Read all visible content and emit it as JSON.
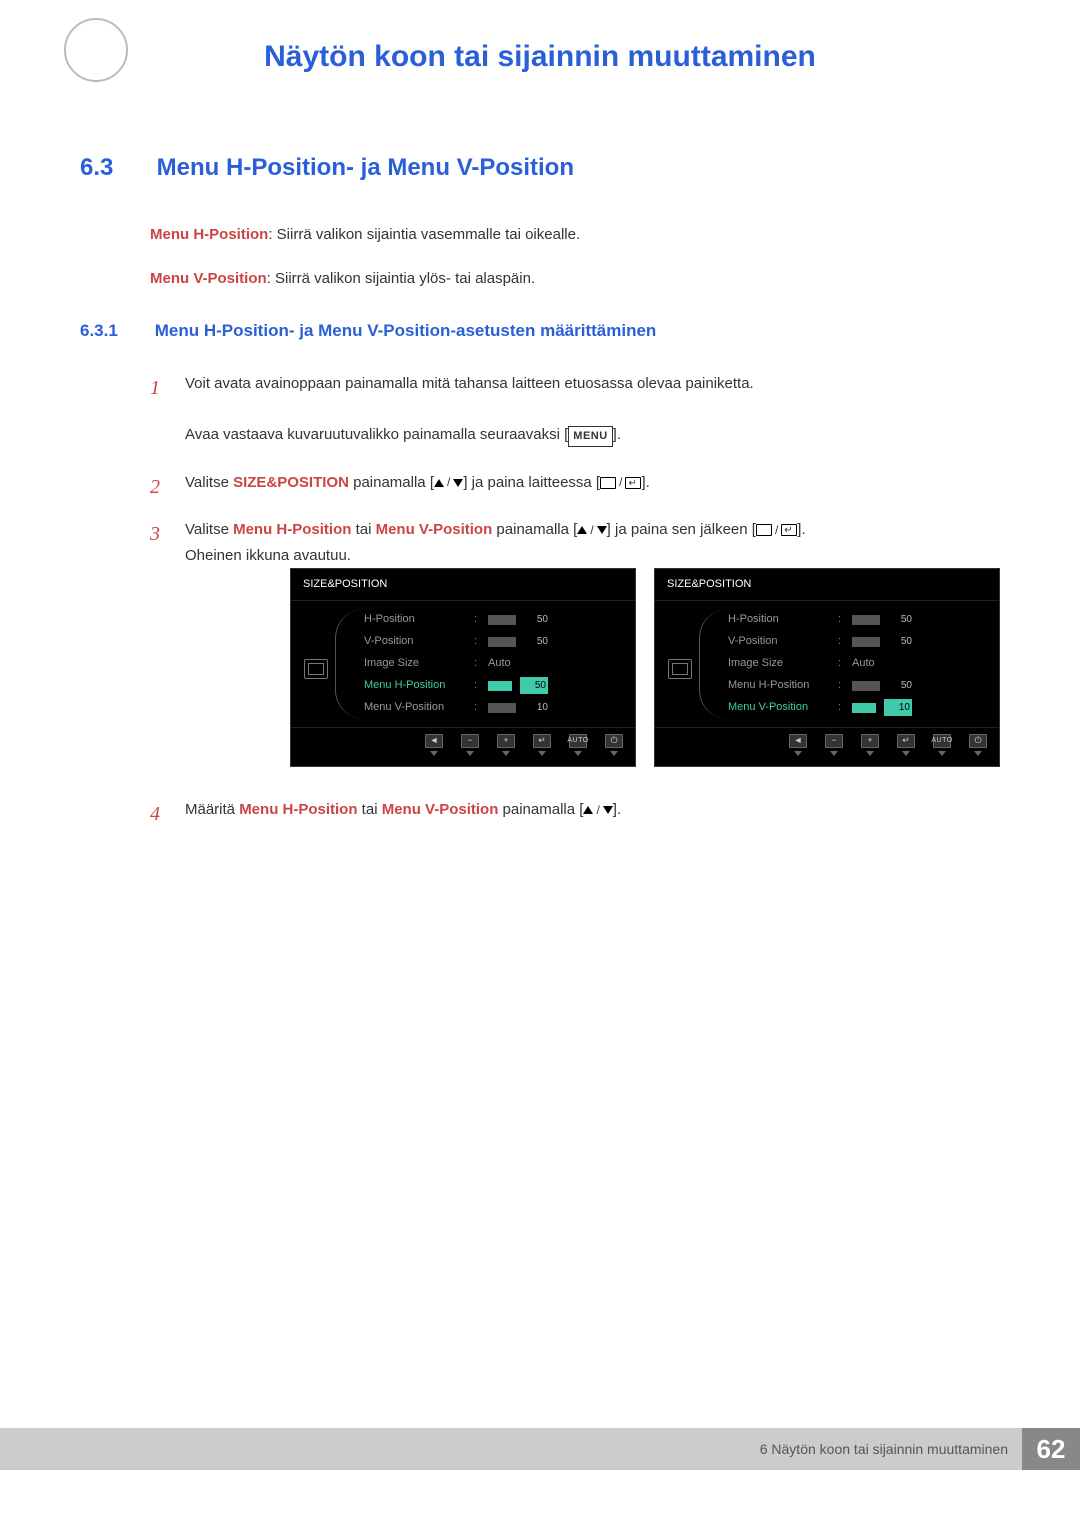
{
  "chapter_title": "Näytön koon tai sijainnin muuttaminen",
  "section": {
    "number": "6.3",
    "title": "Menu H-Position- ja Menu V-Position"
  },
  "intro": {
    "h_label": "Menu H-Position",
    "h_text": ": Siirrä valikon sijaintia vasemmalle tai oikealle.",
    "v_label": "Menu V-Position",
    "v_text": ": Siirrä valikon sijaintia ylös- tai alaspäin."
  },
  "subsection": {
    "number": "6.3.1",
    "title": "Menu H-Position- ja Menu V-Position-asetusten määrittäminen"
  },
  "steps": {
    "s1a": "Voit avata avainoppaan painamalla mitä tahansa laitteen etuosassa olevaa painiketta.",
    "s1b_pre": "Avaa vastaava kuvaruutuvalikko painamalla seuraavaksi [",
    "s1b_key": "MENU",
    "s1b_post": "].",
    "s2_pre": "Valitse ",
    "s2_bold": "SIZE&POSITION",
    "s2_mid": " painamalla [",
    "s2_mid2": "] ja paina laitteessa [",
    "s2_post": "].",
    "s3_pre": "Valitse ",
    "s3_b1": "Menu H-Position",
    "s3_or": " tai ",
    "s3_b2": "Menu V-Position",
    "s3_mid": " painamalla [",
    "s3_mid2": "] ja paina sen jälkeen [",
    "s3_post": "].",
    "s3_line2": "Oheinen ikkuna avautuu.",
    "s4_pre": "Määritä ",
    "s4_b1": "Menu H-Position",
    "s4_or": " tai ",
    "s4_b2": "Menu V-Position",
    "s4_mid": " painamalla [",
    "s4_post": "]."
  },
  "osd": {
    "title": "SIZE&POSITION",
    "items": [
      {
        "label": "H-Position",
        "type": "bar",
        "value": "50"
      },
      {
        "label": "V-Position",
        "type": "bar",
        "value": "50"
      },
      {
        "label": "Image Size",
        "type": "text",
        "value": "Auto"
      },
      {
        "label": "Menu H-Position",
        "type": "bar",
        "value": "50"
      },
      {
        "label": "Menu V-Position",
        "type": "bar",
        "value": "10"
      }
    ],
    "footer_auto": "AUTO",
    "left_selected_index": 3,
    "right_selected_index": 4
  },
  "footer": {
    "text": "6 Näytön koon tai sijainnin muuttaminen",
    "page": "62"
  }
}
